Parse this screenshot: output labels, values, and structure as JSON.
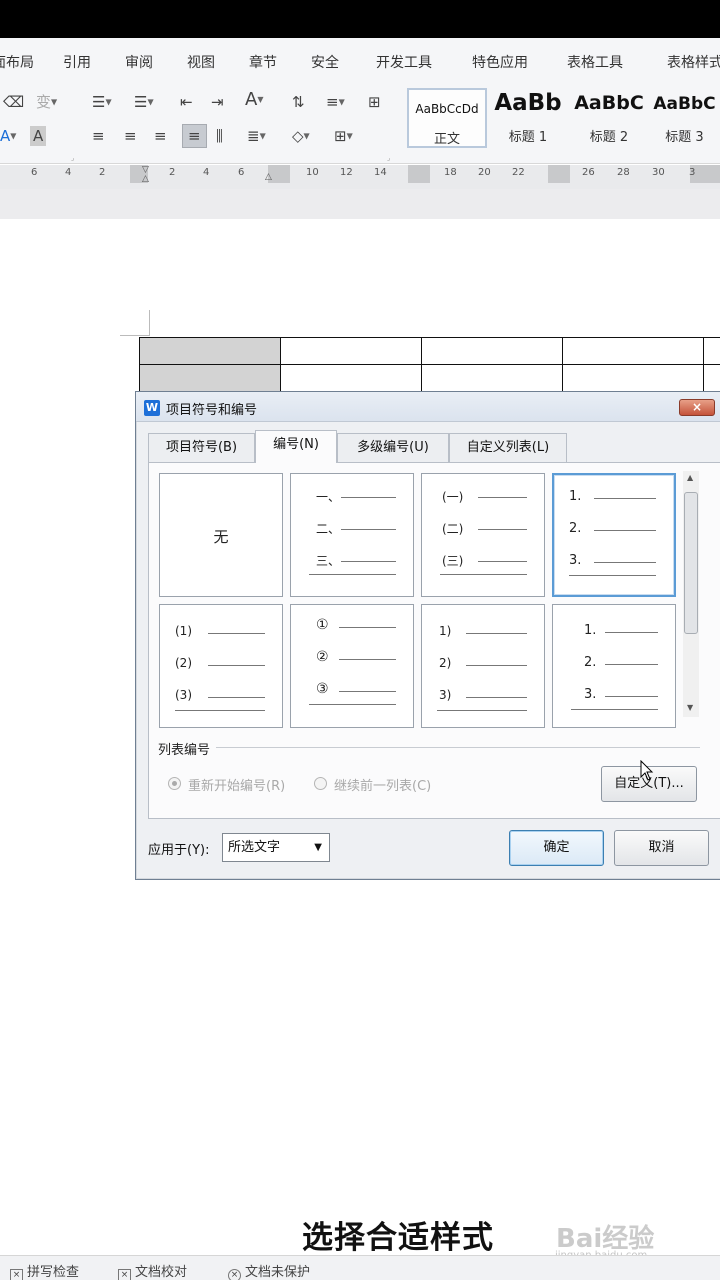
{
  "ribbon": {
    "tabs": [
      "页面布局",
      "引用",
      "审阅",
      "视图",
      "章节",
      "安全",
      "开发工具",
      "特色应用",
      "表格工具",
      "表格样式"
    ],
    "styles": [
      {
        "sample": "AaBbCcDd",
        "name": "正文"
      },
      {
        "sample": "AaBb",
        "name": "标题 1"
      },
      {
        "sample": "AaBbC",
        "name": "标题 2"
      },
      {
        "sample": "AaBbC",
        "name": "标题 3"
      }
    ]
  },
  "ruler": {
    "numbers": [
      "6",
      "4",
      "2",
      "2",
      "4",
      "6",
      "10",
      "12",
      "14",
      "18",
      "20",
      "22",
      "26",
      "28",
      "30",
      "3"
    ]
  },
  "dialog": {
    "title": "项目符号和编号",
    "close_label": "×",
    "tabs": [
      "项目符号(B)",
      "编号(N)",
      "多级编号(U)",
      "自定义列表(L)"
    ],
    "active_tab": 1,
    "options_row1": {
      "none_label": "无",
      "chinese": [
        "一、",
        "二、",
        "三、"
      ],
      "paren_chinese": [
        "(一)",
        "(二)",
        "(三)"
      ],
      "dotted": [
        "1.",
        "2.",
        "3."
      ]
    },
    "options_row2": {
      "paren_num": [
        "(1)",
        "(2)",
        "(3)"
      ],
      "circled": [
        "①",
        "②",
        "③"
      ],
      "half_paren": [
        "1)",
        "2)",
        "3)"
      ],
      "indented_dotted": [
        "1.",
        "2.",
        "3."
      ]
    },
    "list_numbering_label": "列表编号",
    "restart_label": "重新开始编号(R)",
    "continue_label": "继续前一列表(C)",
    "customize_label": "自定义(T)...",
    "apply_to_label": "应用于(Y):",
    "apply_to_value": "所选文字",
    "ok_label": "确定",
    "cancel_label": "取消"
  },
  "caption": "选择合适样式",
  "watermark": {
    "brand": "Bai经验",
    "url": "jingyan.baidu.com"
  },
  "status": {
    "spell_check": "拼写检查",
    "proofread": "文档校对",
    "protect": "文档未保护"
  }
}
